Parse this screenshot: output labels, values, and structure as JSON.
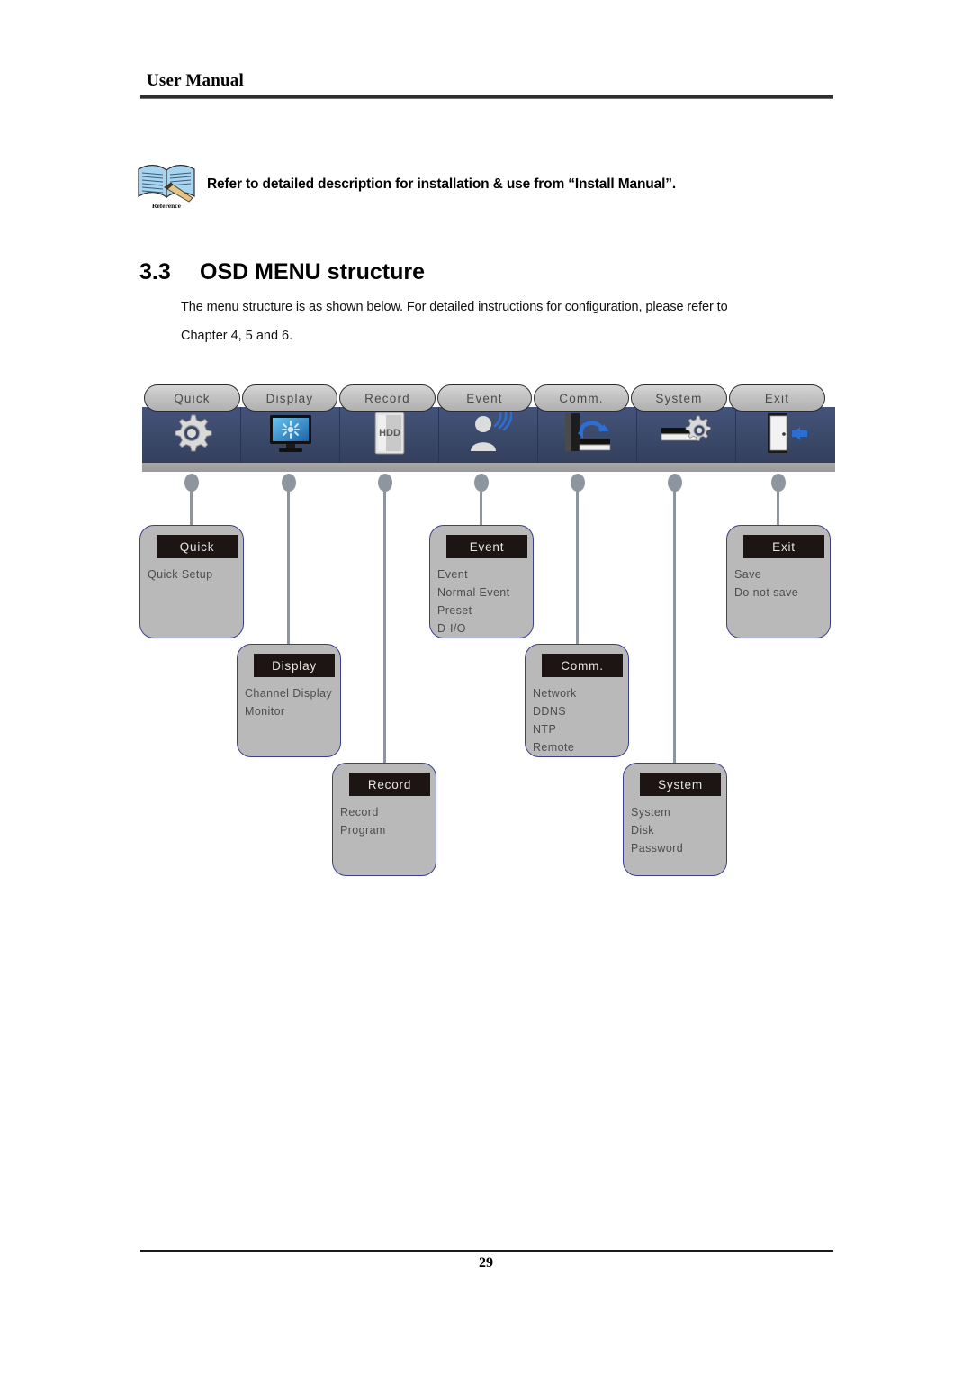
{
  "page": {
    "header_title": "User Manual",
    "page_number": "29"
  },
  "reference": {
    "icon": "open-book-reference-icon",
    "icon_caption": "Reference",
    "text": "Refer to detailed description for installation & use from “Install Manual”."
  },
  "section": {
    "number": "3.3",
    "title": "OSD MENU structure",
    "paragraph_line_1": "The menu structure is as shown below. For detailed instructions for configuration, please refer to",
    "paragraph_line_2": "Chapter 4, 5 and 6."
  },
  "diagram": {
    "menu_bar": {
      "tabs": [
        {
          "label": "Quick",
          "icon": "gear-icon"
        },
        {
          "label": "Display",
          "icon": "monitor-icon"
        },
        {
          "label": "Record",
          "icon": "hdd-icon"
        },
        {
          "label": "Event",
          "icon": "person-sensor-icon"
        },
        {
          "label": "Comm.",
          "icon": "network-sync-icon"
        },
        {
          "label": "System",
          "icon": "device-gear-icon"
        },
        {
          "label": "Exit",
          "icon": "exit-door-icon"
        }
      ]
    },
    "submenus": [
      {
        "title": "Quick",
        "items": [
          "Quick Setup"
        ]
      },
      {
        "title": "Display",
        "items": [
          "Channel Display",
          "Monitor"
        ]
      },
      {
        "title": "Record",
        "items": [
          "Record",
          "Program"
        ]
      },
      {
        "title": "Event",
        "items": [
          "Event",
          "Normal Event",
          "Preset",
          "D-I/O"
        ]
      },
      {
        "title": "Comm.",
        "items": [
          "Network",
          "DDNS",
          "NTP",
          "Remote"
        ]
      },
      {
        "title": "System",
        "items": [
          "System",
          "Disk",
          "Password"
        ]
      },
      {
        "title": "Exit",
        "items": [
          "Save",
          "Do not save"
        ]
      }
    ]
  },
  "colors": {
    "menu_bar_blue": "#3b4a6b",
    "submenu_border": "#3b3f8f",
    "submenu_fill": "#b9b9b9",
    "submenu_title_bg": "#1c1513",
    "connector_gray": "#8d959e"
  }
}
